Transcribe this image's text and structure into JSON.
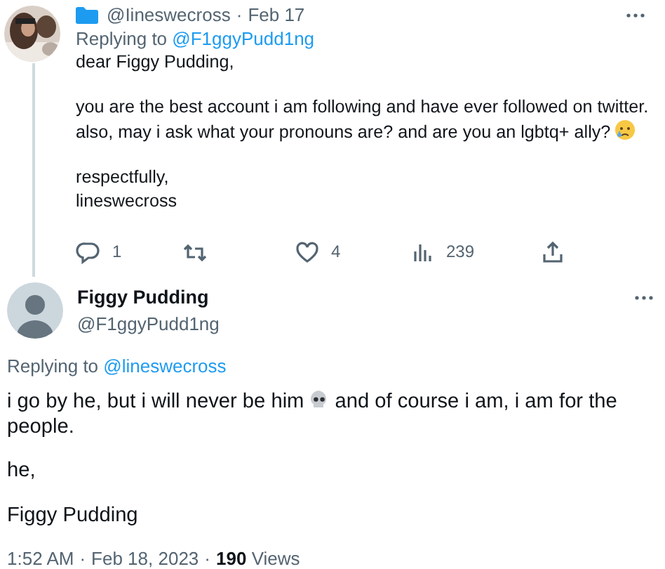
{
  "tweet": {
    "handle": "@Iineswecross",
    "separator": "·",
    "date": "Feb 17",
    "replying_label": "Replying to",
    "replying_to": "@F1ggyPudd1ng",
    "paragraphs": [
      {
        "lines": [
          {
            "kind": "plain",
            "text": "dear Figgy Pudding,"
          }
        ]
      },
      {
        "lines": [
          {
            "kind": "plain",
            "text": "you are the best account i am following and have ever followed on twitter."
          },
          {
            "kind": "crying",
            "text": "also, may i ask what your pronouns are? and are you an lgbtq+ ally?"
          }
        ]
      },
      {
        "lines": [
          {
            "kind": "plain",
            "text": "respectfully,"
          },
          {
            "kind": "plain",
            "text": "lineswecross"
          }
        ]
      }
    ],
    "actions": [
      {
        "kind": "reply",
        "count": "1"
      },
      {
        "kind": "retweet"
      },
      {
        "kind": "like",
        "count": "4"
      },
      {
        "kind": "views",
        "count": "239"
      },
      {
        "kind": "share"
      }
    ]
  },
  "reply": {
    "name": "Figgy Pudding",
    "handle": "@F1ggyPudd1ng",
    "replying_label": "Replying to",
    "replying_to": "@lineswecross",
    "paragraphs": [
      {
        "lines": [
          {
            "kind": "skull",
            "text": "i go by he, but i will never be him",
            "after": "and of course i am, i am for the"
          },
          {
            "kind": "plain",
            "text": "people."
          }
        ]
      },
      {
        "lines": [
          {
            "kind": "plain",
            "text": "he,"
          }
        ]
      },
      {
        "lines": [
          {
            "kind": "plain",
            "text": "Figgy Pudding"
          }
        ]
      }
    ],
    "time": "1:52 AM",
    "separator": "·",
    "date": "Feb 18, 2023",
    "separator_2": "·",
    "views_count": "190",
    "views_label": "Views"
  }
}
